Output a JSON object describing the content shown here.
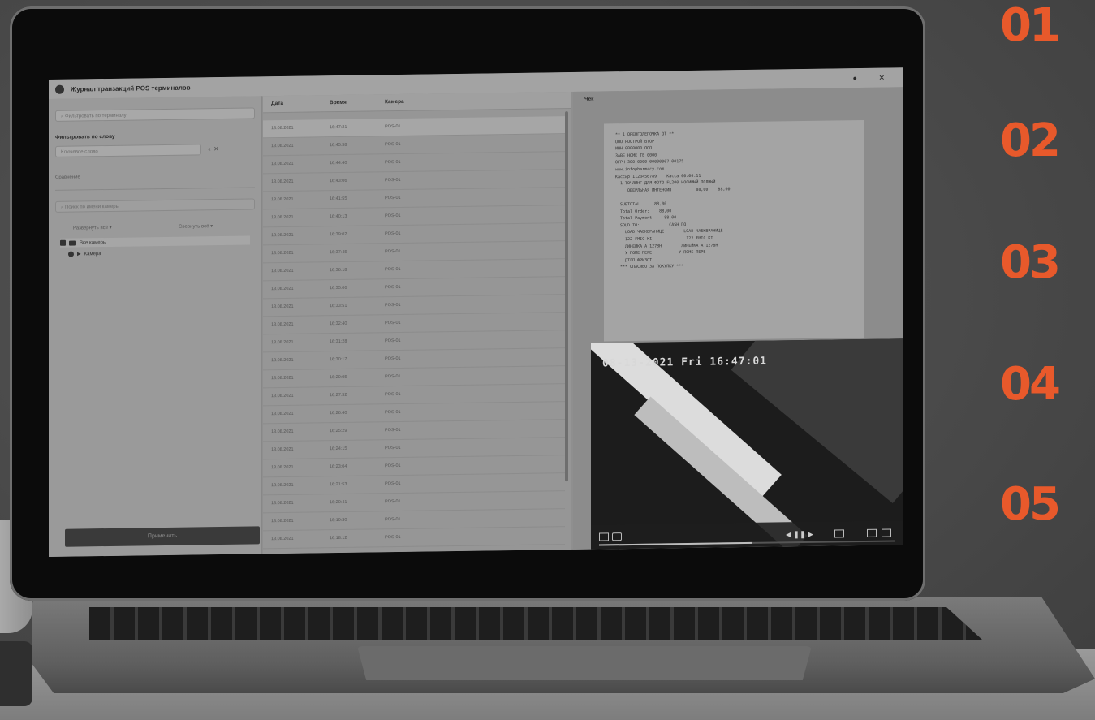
{
  "steps": [
    "01",
    "02",
    "03",
    "04",
    "05"
  ],
  "app": {
    "title": "Журнал транзакций POS терминалов",
    "window_controls": "● ✕"
  },
  "left_panel": {
    "search_placeholder": "Фильтровать по терминалу",
    "section_title": "Фильтровать по слову",
    "keyword_placeholder": "Ключевое слово",
    "case_label": "Сравнение",
    "camera_search_placeholder": "Поиск по имени камеры",
    "expand_all": "Развернуть всё",
    "collapse_all": "Свернуть всё",
    "tree": [
      "Все камеры",
      "Камера"
    ],
    "apply_button": "Применить"
  },
  "table": {
    "columns": [
      "Дата",
      "Время",
      "Камера",
      ""
    ],
    "rows": [
      [
        "13.08.2021",
        "16:47:21",
        "POS-01"
      ],
      [
        "13.08.2021",
        "16:45:58",
        "POS-01"
      ],
      [
        "13.08.2021",
        "16:44:40",
        "POS-01"
      ],
      [
        "13.08.2021",
        "16:43:06",
        "POS-01"
      ],
      [
        "13.08.2021",
        "16:41:55",
        "POS-01"
      ],
      [
        "13.08.2021",
        "16:40:13",
        "POS-01"
      ],
      [
        "13.08.2021",
        "16:39:02",
        "POS-01"
      ],
      [
        "13.08.2021",
        "16:37:45",
        "POS-01"
      ],
      [
        "13.08.2021",
        "16:36:18",
        "POS-01"
      ],
      [
        "13.08.2021",
        "16:35:06",
        "POS-01"
      ],
      [
        "13.08.2021",
        "16:33:51",
        "POS-01"
      ],
      [
        "13.08.2021",
        "16:32:40",
        "POS-01"
      ],
      [
        "13.08.2021",
        "16:31:28",
        "POS-01"
      ],
      [
        "13.08.2021",
        "16:30:17",
        "POS-01"
      ],
      [
        "13.08.2021",
        "16:29:05",
        "POS-01"
      ],
      [
        "13.08.2021",
        "16:27:52",
        "POS-01"
      ],
      [
        "13.08.2021",
        "16:26:40",
        "POS-01"
      ],
      [
        "13.08.2021",
        "16:25:29",
        "POS-01"
      ],
      [
        "13.08.2021",
        "16:24:15",
        "POS-01"
      ],
      [
        "13.08.2021",
        "16:23:04",
        "POS-01"
      ],
      [
        "13.08.2021",
        "16:21:53",
        "POS-01"
      ],
      [
        "13.08.2021",
        "16:20:41",
        "POS-01"
      ],
      [
        "13.08.2021",
        "16:19:30",
        "POS-01"
      ],
      [
        "13.08.2021",
        "16:18:12",
        "POS-01"
      ]
    ]
  },
  "right_panel": {
    "header": "Чек",
    "receipt_lines": [
      "** 1 ОРЕНГОЛЕПОЧКА ОТ **",
      "ООО РОСТРОЙ ВТОР",
      "ИНН 0000000 ООО",
      "ЗАВЕ НОМЕ ТЕ 0000",
      "ОГРН 300 0000 00000067 00175",
      "www.infopharmacy.com",
      "Кассир 1123456789    Касса 00:00:11",
      "  1 ТОЧЛИНГ ДЛЯ ФОТО FL200 НОСИМЫЙ ПОЛНЫЙ",
      "     ОВЕРЛЬНАЯ ИНТЕНСИВ          88,00    88,00",
      "",
      "  SUBTOTAL      88,00",
      "  Total Order:    88,00",
      "  Total Payment:    88,00",
      "  SOLD TO:            CASH ПО",
      "    LOAD ЧАЕКВРАНИЦЕ        LOAD ЧАЕКВРАНИЦЕ",
      "    122 FMIC KI              122 FMIC KI",
      "    ЛИНЕЙКА А 1278Н        ЛИНЕЙКА А 1278Н",
      "    У ПОМЕ ПЕРЕ           У ПОМЕ ПЕРЕ",
      "    ДТЛП ФРИЗОТ",
      "  *** СПАСИБО ЗА ПОКУПКУ ***"
    ],
    "video": {
      "timestamp": "08-13-2021 Fri 16:47:01",
      "progress": 0.52
    }
  }
}
